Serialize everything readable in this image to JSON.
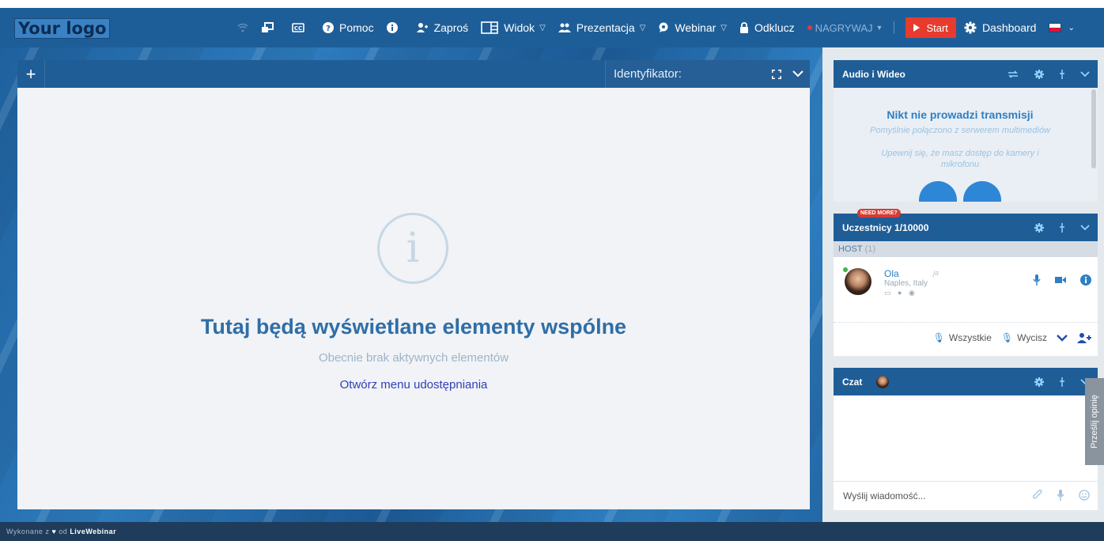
{
  "logo": "Your logo",
  "nav": {
    "help": "Pomoc",
    "invite": "Zaproś",
    "view": "Widok",
    "presentation": "Prezentacja",
    "webinar": "Webinar",
    "unlock": "Odklucz",
    "record": "NAGRYWAJ",
    "start": "Start",
    "dashboard": "Dashboard"
  },
  "stage": {
    "identifier_label": "Identyfikator:",
    "title": "Tutaj będą wyświetlane elementy wspólne",
    "subtitle": "Obecnie brak aktywnych elementów",
    "link": "Otwórz menu udostępniania"
  },
  "av_panel": {
    "title": "Audio i Wideo",
    "heading": "Nikt nie prowadzi transmisji",
    "line1": "Pomyślnie połączono z serwerem multimediów",
    "line2": "Upewnij się, że masz dostęp do kamery i mikrofonu"
  },
  "participants": {
    "badge": "NEED MORE?",
    "title": "Uczestnicy 1/10000",
    "host_label": "HOST",
    "host_count": "(1)",
    "user": {
      "name": "Ola",
      "tag": "ja",
      "location": "Naples, Italy"
    },
    "all_label": "Wszystkie",
    "mute_label": "Wycisz"
  },
  "chat": {
    "title": "Czat",
    "placeholder": "Wyślij wiadomość..."
  },
  "feedback": "Prześlij opinię",
  "footer": {
    "made_with": "Wykonane z",
    "by": "od",
    "brand": "LiveWebinar"
  },
  "colors": {
    "navbar": "#1e5e98",
    "start_button": "#e63b2e",
    "accent": "#2e7fc4",
    "stage_title": "#2f6ea7"
  }
}
